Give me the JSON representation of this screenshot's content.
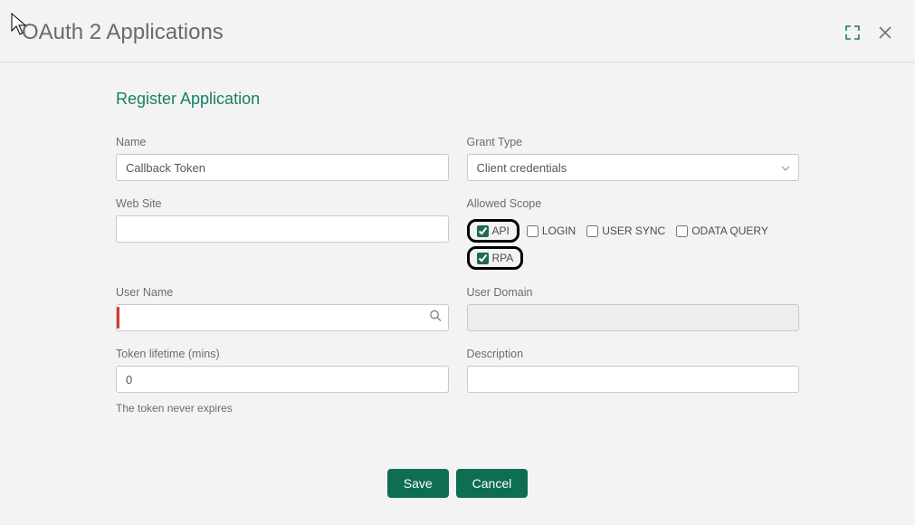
{
  "header": {
    "title": "OAuth 2 Applications"
  },
  "form": {
    "subtitle": "Register Application",
    "name": {
      "label": "Name",
      "value": "Callback Token"
    },
    "grant_type": {
      "label": "Grant Type",
      "value": "Client credentials"
    },
    "website": {
      "label": "Web Site",
      "value": ""
    },
    "allowed_scope": {
      "label": "Allowed Scope",
      "options": [
        {
          "label": "API",
          "checked": true,
          "highlight": true
        },
        {
          "label": "LOGIN",
          "checked": false,
          "highlight": false
        },
        {
          "label": "USER SYNC",
          "checked": false,
          "highlight": false
        },
        {
          "label": "ODATA QUERY",
          "checked": false,
          "highlight": false
        },
        {
          "label": "RPA",
          "checked": true,
          "highlight": true
        }
      ]
    },
    "user_name": {
      "label": "User Name",
      "value": ""
    },
    "user_domain": {
      "label": "User Domain",
      "value": ""
    },
    "token_lifetime": {
      "label": "Token lifetime (mins)",
      "value": "0",
      "helper": "The token never expires"
    },
    "description": {
      "label": "Description",
      "value": ""
    }
  },
  "buttons": {
    "save": "Save",
    "cancel": "Cancel"
  }
}
